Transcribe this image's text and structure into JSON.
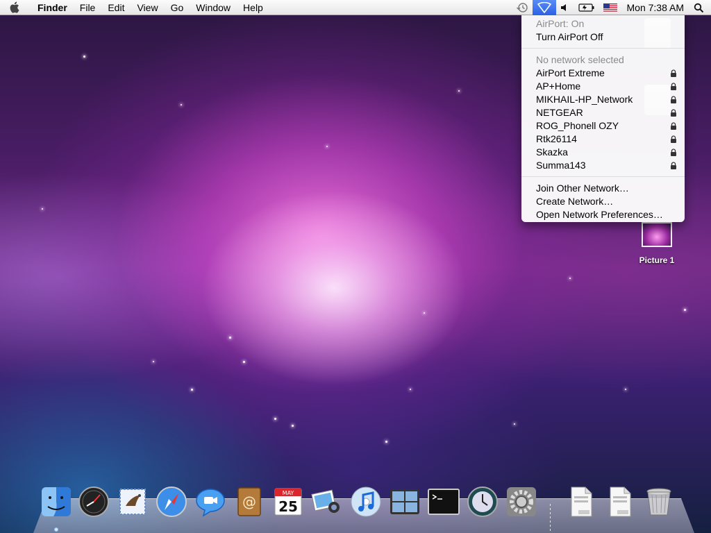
{
  "menubar": {
    "app_name": "Finder",
    "menus": [
      "File",
      "Edit",
      "View",
      "Go",
      "Window",
      "Help"
    ],
    "clock": "Mon 7:38 AM",
    "status_icons": [
      "time-machine-icon",
      "airport-icon",
      "volume-icon",
      "battery-icon",
      "flag-icon",
      "spotlight-icon"
    ]
  },
  "airport_menu": {
    "status": "AirPort: On",
    "toggle": "Turn AirPort Off",
    "no_network": "No network selected",
    "networks": [
      {
        "name": "AirPort Extreme",
        "locked": true
      },
      {
        "name": "AP+Home",
        "locked": true
      },
      {
        "name": "MIKHAIL-HP_Network",
        "locked": true
      },
      {
        "name": "NETGEAR",
        "locked": true
      },
      {
        "name": "ROG_Phonell OZY",
        "locked": true
      },
      {
        "name": "Rtk26114",
        "locked": true
      },
      {
        "name": "Skazka",
        "locked": true
      },
      {
        "name": "Summa143",
        "locked": true
      }
    ],
    "join_other": "Join Other Network…",
    "create": "Create Network…",
    "preferences": "Open Network Preferences…"
  },
  "desktop": {
    "icons": [
      {
        "label": "Picture 1",
        "icon": "screenshot-thumbnail-icon"
      }
    ]
  },
  "dock": {
    "apps": [
      "finder-icon",
      "dashboard-icon",
      "mail-icon",
      "safari-icon",
      "ichat-icon",
      "address-book-icon",
      "ical-icon",
      "iphoto-icon",
      "itunes-icon",
      "spaces-icon",
      "terminal-icon",
      "time-machine-icon",
      "system-preferences-icon"
    ],
    "calendar_month": "MAY",
    "calendar_day": "25",
    "docs": [
      "pdf-document-icon",
      "pdf-document-icon",
      "trash-icon"
    ]
  }
}
